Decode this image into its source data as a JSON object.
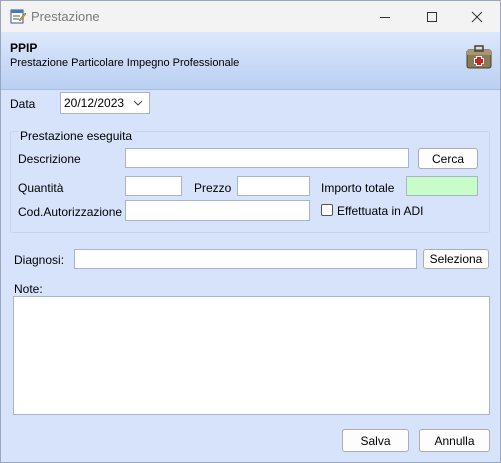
{
  "window": {
    "title": "Prestazione",
    "icon": "edit-document-icon",
    "controls": [
      "minimize-icon",
      "maximize-icon",
      "close-icon"
    ]
  },
  "header": {
    "title": "PPIP",
    "subtitle": "Prestazione Particolare Impegno Professionale",
    "icon": "medical-kit-icon"
  },
  "data": {
    "label": "Data",
    "value": "20/12/2023"
  },
  "prestazione": {
    "group_title": "Prestazione eseguita",
    "descrizione_label": "Descrizione",
    "descrizione_value": "",
    "cerca_button": "Cerca",
    "quantita_label": "Quantità",
    "quantita_value": "",
    "prezzo_label": "Prezzo",
    "prezzo_value": "",
    "importo_label": "Importo totale",
    "importo_value": "",
    "importo_color": "#c8fcc8",
    "autorizzazione_label": "Cod.Autorizzazione",
    "autorizzazione_value": "",
    "adi_label": "Effettuata in ADI",
    "adi_checked": false
  },
  "diagnosi": {
    "label": "Diagnosi:",
    "value": "",
    "seleziona_button": "Seleziona"
  },
  "note": {
    "label": "Note:",
    "value": ""
  },
  "footer": {
    "save_label": "Salva",
    "cancel_label": "Annulla"
  }
}
